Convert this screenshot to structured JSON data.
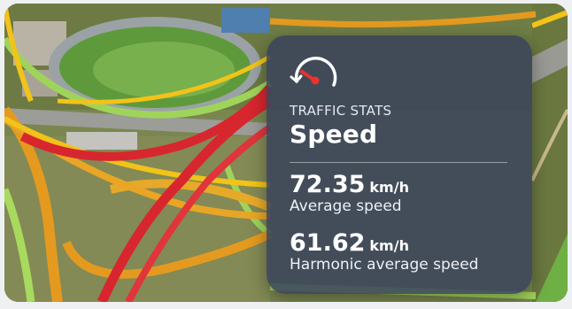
{
  "card": {
    "icon": "speedometer-icon",
    "eyebrow": "TRAFFIC STATS",
    "title": "Speed",
    "stats": [
      {
        "value": "72.35",
        "unit": "km/h",
        "label": "Average speed"
      },
      {
        "value": "61.62",
        "unit": "km/h",
        "label": "Harmonic average speed"
      }
    ]
  },
  "colors": {
    "card_bg": "#3a445c",
    "lane_red": "#d8262f",
    "lane_orange": "#e49a1f",
    "lane_green": "#9fd45a",
    "lane_yellow": "#f2c319"
  }
}
